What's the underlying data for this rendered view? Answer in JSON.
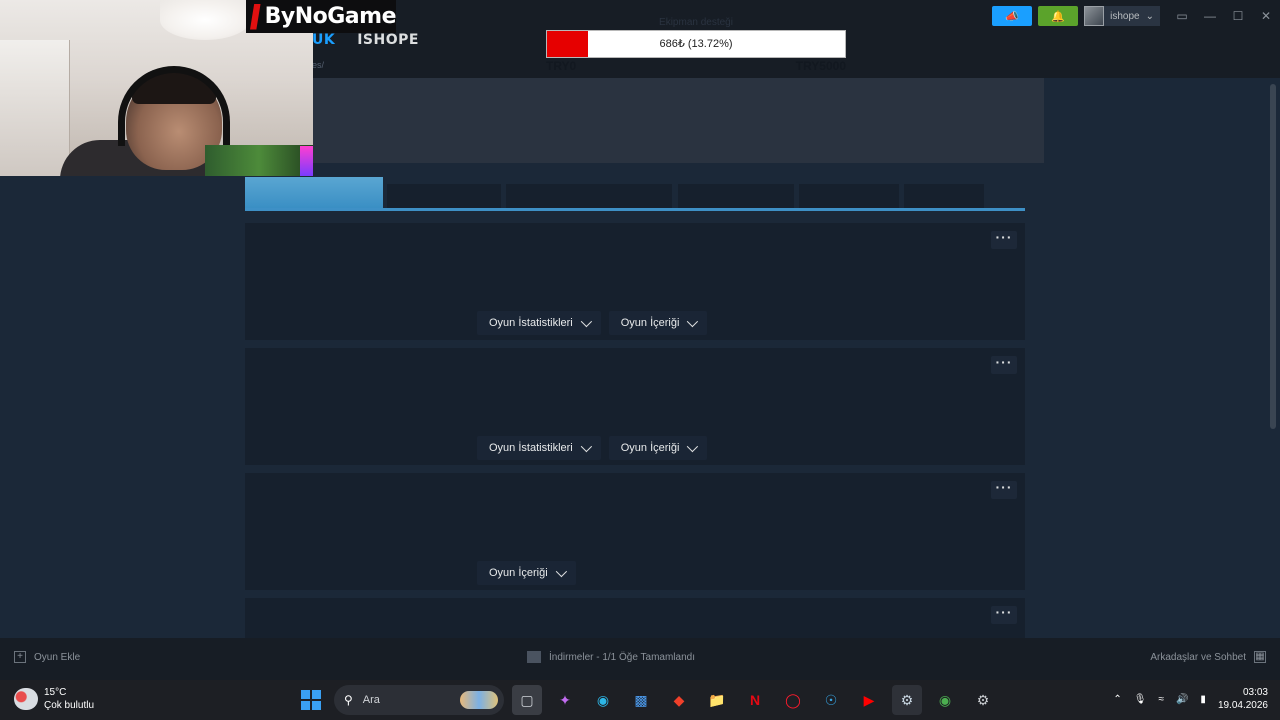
{
  "overlay": {
    "logo_text": "ByNoGame",
    "donation": {
      "title": "Ekipman desteği",
      "progress_label": "686₺ (13.72%)",
      "progress_fraction": 0.1372,
      "min_label": "TRY0",
      "max_label": "TRY5000",
      "fill_color": "#e60000"
    }
  },
  "steam": {
    "nav": {
      "active_item": "UK",
      "user_item": "İSHOPE"
    },
    "url_fragment": "es/",
    "header": {
      "user_name": "ishope",
      "announce_color": "#1a9fff",
      "notify_color": "#5ba32b"
    },
    "cards": [
      {
        "actions": [
          "Oyun İstatistikleri",
          "Oyun İçeriği"
        ]
      },
      {
        "actions": [
          "Oyun İstatistikleri",
          "Oyun İçeriği"
        ]
      },
      {
        "actions": [
          "Oyun İçeriği"
        ]
      },
      {
        "actions": []
      }
    ],
    "status": {
      "add_game": "Oyun Ekle",
      "downloads": "İndirmeler - 1/1 Öğe Tamamlandı",
      "friends": "Arkadaşlar ve Sohbet"
    }
  },
  "taskbar": {
    "weather_temp": "15°C",
    "weather_desc": "Çok bulutlu",
    "weather_badge": "1",
    "search_placeholder": "Ara",
    "time": "03:03",
    "date": "19.04.2026"
  }
}
